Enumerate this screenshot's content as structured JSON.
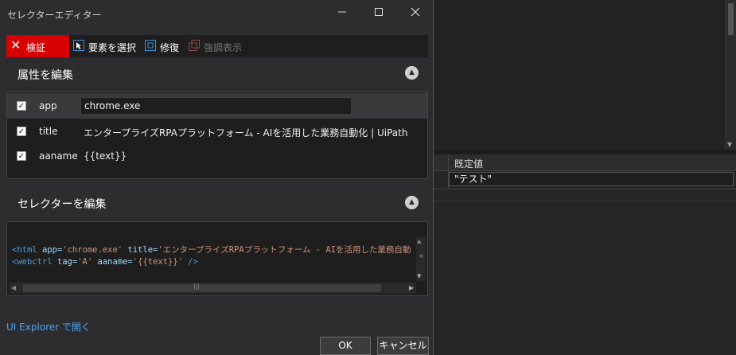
{
  "window": {
    "title": "セレクターエディター"
  },
  "toolbar": {
    "validate": "検証",
    "select_element": "要素を選択",
    "repair": "修復",
    "highlight": "強調表示"
  },
  "attributes_section": {
    "title": "属性を編集"
  },
  "attributes": [
    {
      "name": "app",
      "value": "chrome.exe",
      "checked": true
    },
    {
      "name": "title",
      "value": "エンタープライズRPAプラットフォーム - AIを活用した業務自動化 | UiPath",
      "checked": true
    },
    {
      "name": "aaname",
      "value": "{{text}}",
      "checked": true
    }
  ],
  "selector_section": {
    "title": "セレクターを編集"
  },
  "selector": {
    "line1": {
      "open": "<html ",
      "a1": "app=",
      "v1": "'chrome.exe'",
      "a2": " title=",
      "v2": "'エンタープライズRPAプラットフォーム - AIを活用した業務自動化 | UiPath' />"
    },
    "line2": {
      "open": "<webctrl ",
      "a1": "tag=",
      "v1": "'A'",
      "a2": " aaname=",
      "v2": "'{{text}}'",
      "close": " />"
    }
  },
  "ui_explorer_link": "UI Explorer で開く",
  "buttons": {
    "ok": "OK",
    "cancel": "キャンセル"
  },
  "background_panel": {
    "grid_header": "既定値",
    "grid_value": "\"テスト\""
  },
  "colors": {
    "validate_bg": "#d70000",
    "link": "#4ea1f3",
    "accent_border": "#3a5f8c"
  }
}
